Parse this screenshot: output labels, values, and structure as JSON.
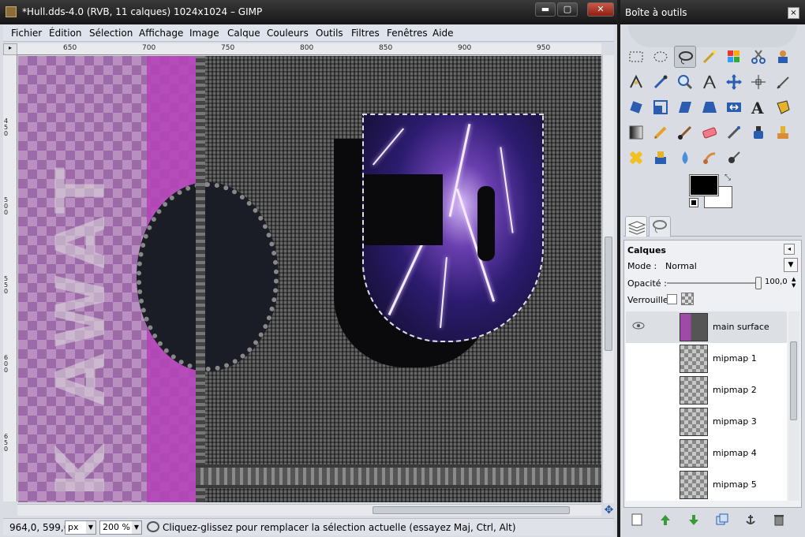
{
  "main_window": {
    "title": "*Hull.dds-4.0 (RVB, 11 calques) 1024x1024 – GIMP",
    "controls": {
      "minimize": "▬",
      "maximize": "▢",
      "close": "✕"
    }
  },
  "menu": [
    "Fichier",
    "Édition",
    "Sélection",
    "Affichage",
    "Image",
    "Calque",
    "Couleurs",
    "Outils",
    "Filtres",
    "Fenêtres",
    "Aide"
  ],
  "ruler_top": [
    "650",
    "700",
    "750",
    "800",
    "850",
    "900",
    "950"
  ],
  "ruler_left": [
    "450",
    "500",
    "550",
    "600",
    "650"
  ],
  "canvas_text": "K AWAT",
  "status": {
    "coords": "964,0, 599,0",
    "unit": "px",
    "zoom": "200 %",
    "message": "Cliquez-glissez pour remplacer la sélection actuelle (essayez Maj, Ctrl, Alt)"
  },
  "toolbox": {
    "title": "Boîte à outils",
    "close": "×",
    "selected_tool": "free-select-tool",
    "colors": {
      "foreground": "#000000",
      "background": "#ffffff"
    },
    "tools": [
      "rect-select",
      "ellipse-select",
      "free-select",
      "fuzzy-select",
      "color-select",
      "scissors",
      "foreground-select",
      "paths",
      "color-picker",
      "zoom",
      "measure",
      "move",
      "align",
      "crop",
      "rotate",
      "scale",
      "shear",
      "perspective",
      "flip",
      "text",
      "cage",
      "blend",
      "pencil",
      "paintbrush",
      "eraser",
      "airbrush",
      "ink",
      "clone",
      "heal",
      "perspective-clone",
      "blur",
      "smudge",
      "dodge-burn"
    ]
  },
  "layers_panel": {
    "title": "Calques",
    "mode_label": "Mode :",
    "mode_value": "Normal",
    "opacity_label": "Opacité :",
    "opacity_value": "100,0",
    "lock_label": "Verrouiller :",
    "layers": [
      {
        "name": "main surface",
        "visible": true,
        "active": true
      },
      {
        "name": "mipmap 1",
        "visible": false,
        "active": false
      },
      {
        "name": "mipmap 2",
        "visible": false,
        "active": false
      },
      {
        "name": "mipmap 3",
        "visible": false,
        "active": false
      },
      {
        "name": "mipmap 4",
        "visible": false,
        "active": false
      },
      {
        "name": "mipmap 5",
        "visible": false,
        "active": false
      },
      {
        "name": "",
        "visible": false,
        "active": false
      }
    ]
  }
}
